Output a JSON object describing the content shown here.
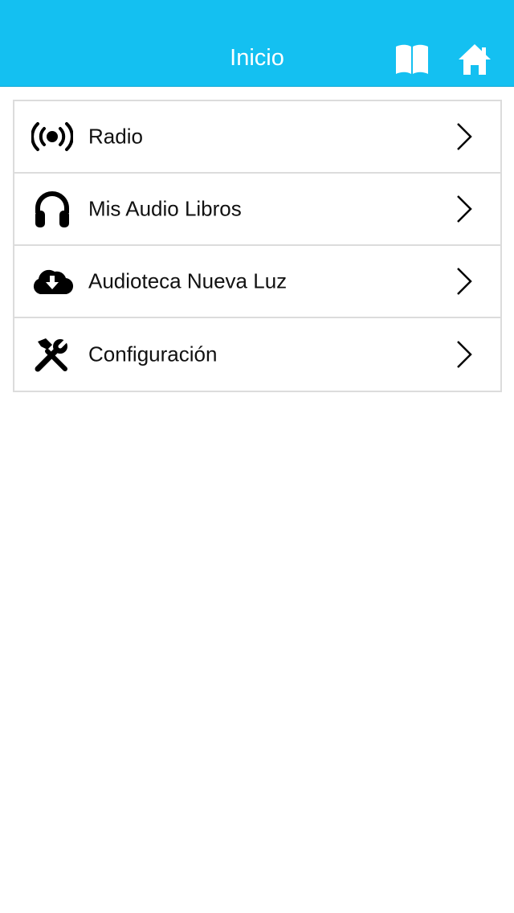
{
  "header": {
    "title": "Inicio",
    "background_color": "#14c0f1",
    "actions": [
      {
        "name": "book-icon",
        "icon": "open-book"
      },
      {
        "name": "home-icon",
        "icon": "house"
      }
    ]
  },
  "menu": {
    "items": [
      {
        "label": "Radio",
        "icon": "radio-broadcast-icon"
      },
      {
        "label": "Mis Audio Libros",
        "icon": "headphones-icon"
      },
      {
        "label": "Audioteca Nueva Luz",
        "icon": "cloud-download-icon"
      },
      {
        "label": "Configuración",
        "icon": "tools-icon"
      }
    ]
  }
}
